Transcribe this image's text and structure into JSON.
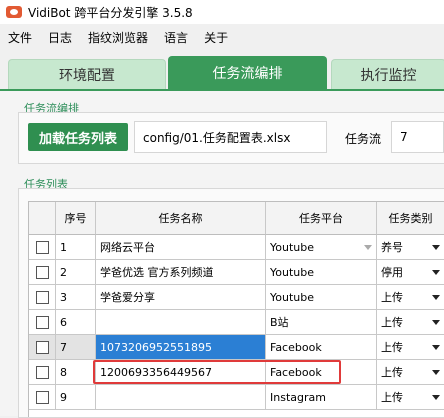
{
  "window": {
    "title": "VidiBot 跨平台分发引擎 3.5.8"
  },
  "menu": [
    "文件",
    "日志",
    "指纹浏览器",
    "语言",
    "关于"
  ],
  "tabs": [
    "环境配置",
    "任务流编排",
    "执行监控"
  ],
  "active_tab": "任务流编排",
  "flow_section": {
    "label": "任务流编排",
    "load_button": "加载任务列表",
    "config_path": "config/01.任务配置表.xlsx",
    "flow_label": "任务流",
    "flow_value": "7"
  },
  "task_list": {
    "label": "任务列表",
    "columns": [
      "",
      "序号",
      "任务名称",
      "任务平台",
      "任务类别"
    ],
    "rows": [
      {
        "no": "1",
        "name": "网络云平台",
        "platform": "Youtube",
        "category": "养号"
      },
      {
        "no": "2",
        "name": "学爸优选 官方系列频道",
        "platform": "Youtube",
        "category": "停用"
      },
      {
        "no": "3",
        "name": "学爸爱分享",
        "platform": "Youtube",
        "category": "上传"
      },
      {
        "no": "6",
        "name": "",
        "platform": "B站",
        "category": "上传"
      },
      {
        "no": "7",
        "name": "1073206952551895",
        "platform": "Facebook",
        "category": "上传"
      },
      {
        "no": "8",
        "name": "1200693356449567",
        "platform": "Facebook",
        "category": "上传"
      },
      {
        "no": "9",
        "name": "",
        "platform": "Instagram",
        "category": "上传"
      }
    ]
  }
}
